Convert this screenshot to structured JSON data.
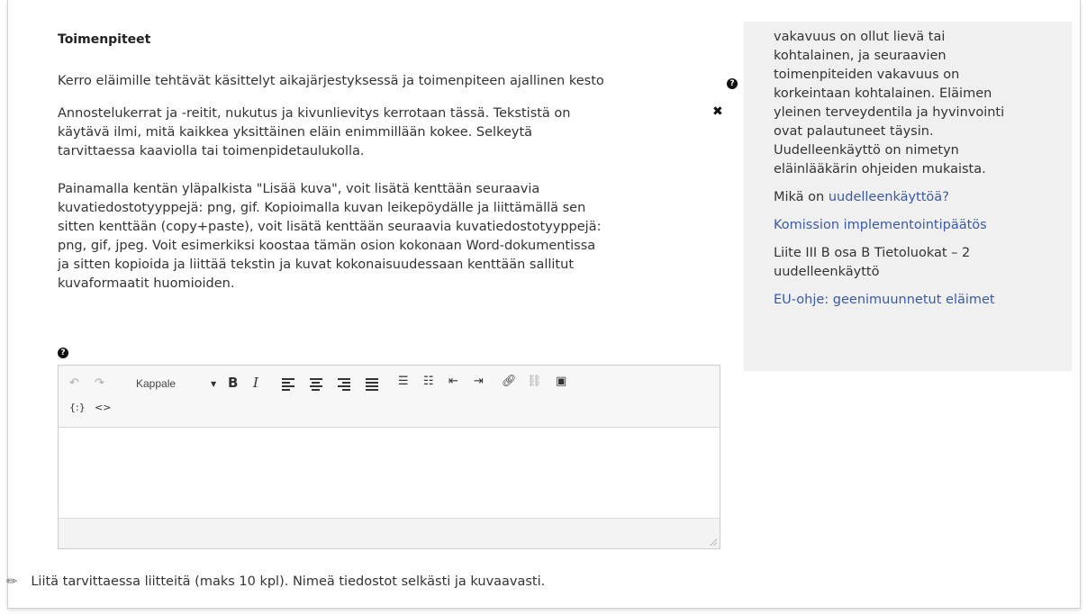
{
  "section": {
    "title": "Toimenpiteet",
    "question": "Kerro eläimille tehtävät käsittelyt aikajärjestyksessä ja toimenpiteen ajallinen kesto"
  },
  "help": {
    "paragraph1": "Annostelukerrat ja -reitit, nukutus ja kivunlievitys kerrotaan tässä. Tekstistä on\nkäytävä ilmi, mitä kaikkea yksittäinen eläin enimmillään kokee. Selkeytä\ntarvittaessa kaaviolla tai toimenpidetaulukolla.",
    "paragraph2": "Painamalla kentän yläpalkista \"Lisää kuva\", voit lisätä kenttään seuraavia\nkuvatiedostotyyppejä: png, gif. Kopioimalla kuvan leikepöydälle ja liittämällä sen\nsitten kenttään (copy+paste), voit lisätä kenttään seuraavia kuvatiedostotyyppejä:\npng, gif, jpeg. Voit esimerkiksi koostaa tämän osion kokonaan Word-dokumentissa\nja sitten kopioida ja liittää tekstin ja kuvat kokonaisuudessaan kenttään sallitut\nkuvaformaatit huomioiden."
  },
  "editor": {
    "format_select": "Kappale",
    "bold_label": "B",
    "italic_label": "I",
    "variable_label": "{:}",
    "source_label": "<>",
    "content": ""
  },
  "attachments": {
    "text": "Liitä tarvittaessa liitteitä (maks 10 kpl). Nimeä tiedostot selkästi ja kuvaavasti."
  },
  "sidebar": {
    "text_block": "vakavuus on ollut lievä tai\nkohtalainen, ja seuraavien\ntoimenpiteiden vakavuus on\nkorkeintaan kohtalainen. Eläimen\nyleinen terveydentila ja hyvinvointi\novat palautuneet täysin.\nUudelleenkäyttö on nimetyn\neläinlääkärin ohjeiden mukaista.",
    "question_prefix": "Mikä on ",
    "question_link": "uudelleenkäyttöä?",
    "link_commission": "Komission implementointipäätös",
    "annex_text": "Liite III B osa B Tietoluokat – 2\nuudelleenkäyttö",
    "link_eu": "EU-ohje: geenimuunnetut eläimet"
  },
  "colors": {
    "link": "#3a59a8",
    "sidebar_bg": "#f0f0f0",
    "toolbar_bg": "#f7f7f7"
  }
}
